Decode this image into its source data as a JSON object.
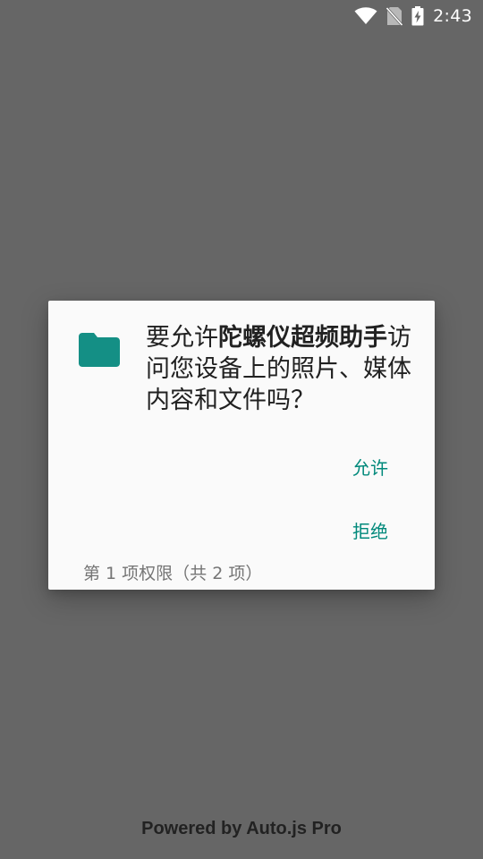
{
  "status_bar": {
    "time": "2:43",
    "icons": [
      "wifi-icon",
      "no-sim-icon",
      "battery-charging-icon"
    ],
    "color": "#ffffff"
  },
  "dialog": {
    "message_prefix": "要允许",
    "app_name": "陀螺仪超频助手",
    "message_suffix": "访问您设备上的照片、媒体内容和文件吗？",
    "allow_label": "允许",
    "deny_label": "拒绝",
    "counter": "第 1 项权限（共 2 项）",
    "icon": "folder-icon",
    "accent_color": "#00897b"
  },
  "footer": {
    "text": "Powered by Auto.js Pro"
  },
  "colors": {
    "scrim": "#666666",
    "dialog_bg": "#fafafa",
    "accent": "#00897b"
  }
}
